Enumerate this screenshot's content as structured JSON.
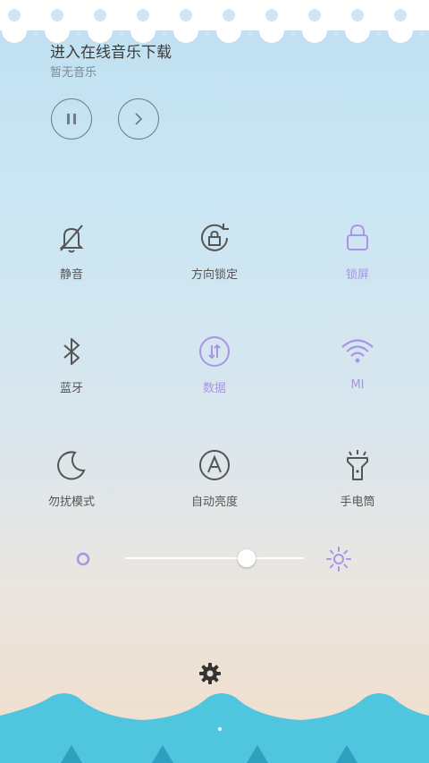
{
  "music": {
    "title": "进入在线音乐下载",
    "subtitle": "暂无音乐"
  },
  "controls": {
    "pause_icon": "pause-icon",
    "next_icon": "chevron-right-icon"
  },
  "toggles": [
    {
      "label": "静音",
      "icon": "mute-bell-icon",
      "active": false
    },
    {
      "label": "方向锁定",
      "icon": "rotation-lock-icon",
      "active": false
    },
    {
      "label": "锁屏",
      "icon": "lock-icon",
      "active": true
    },
    {
      "label": "蓝牙",
      "icon": "bluetooth-icon",
      "active": false
    },
    {
      "label": "数据",
      "icon": "data-icon",
      "active": true
    },
    {
      "label": "MI",
      "icon": "wifi-icon",
      "active": true
    },
    {
      "label": "勿扰模式",
      "icon": "moon-icon",
      "active": false
    },
    {
      "label": "自动亮度",
      "icon": "auto-brightness-icon",
      "active": false
    },
    {
      "label": "手电筒",
      "icon": "flashlight-icon",
      "active": false
    }
  ],
  "brightness": {
    "level": 0.68,
    "low_icon": "brightness-low-icon",
    "high_icon": "brightness-high-icon"
  },
  "colors": {
    "active": "#a995e6",
    "inactive": "#555555",
    "wave": "#4fc6de"
  }
}
